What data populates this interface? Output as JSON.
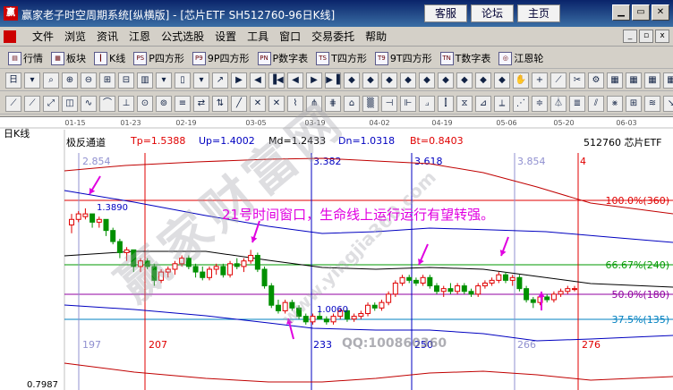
{
  "window": {
    "title": "赢家老子时空周期系统[纵横版] - [芯片ETF  SH512760-96日K线]",
    "top_links": [
      "客服",
      "论坛",
      "主页"
    ],
    "app_icon": "赢"
  },
  "menu": {
    "items": [
      "文件",
      "浏览",
      "资讯",
      "江恩",
      "公式选股",
      "设置",
      "工具",
      "窗口",
      "交易委托",
      "帮助"
    ]
  },
  "toolbar1": {
    "items": [
      {
        "icon": "market-icon",
        "glyph": "▤",
        "label": "行情"
      },
      {
        "icon": "sector-icon",
        "glyph": "▦",
        "label": "板块"
      },
      {
        "icon": "kline-icon",
        "glyph": "┃",
        "label": "K线"
      },
      {
        "icon": "ps-icon",
        "glyph": "PS",
        "label": "P四方形"
      },
      {
        "icon": "p9-icon",
        "glyph": "P9",
        "label": "9P四方形"
      },
      {
        "icon": "pn-icon",
        "glyph": "PN",
        "label": "P数字表"
      },
      {
        "icon": "ts-icon",
        "glyph": "TS",
        "label": "T四方形"
      },
      {
        "icon": "t9-icon",
        "glyph": "T9",
        "label": "9T四方形"
      },
      {
        "icon": "tn-icon",
        "glyph": "TN",
        "label": "T数字表"
      },
      {
        "icon": "gann-wheel-icon",
        "glyph": "◎",
        "label": "江恩轮"
      }
    ]
  },
  "chart_header": {
    "panel_label": "日K线",
    "indicator_name": "极反通道",
    "values": [
      {
        "label": "Tp=1.5388",
        "color": "#e00000"
      },
      {
        "label": "Up=1.4002",
        "color": "#0000c0"
      },
      {
        "label": "Md=1.2433",
        "color": "#000000"
      },
      {
        "label": "Dn=1.0318",
        "color": "#0000c0"
      },
      {
        "label": "Bt=0.8403",
        "color": "#e00000"
      }
    ],
    "symbol": "512760 芯片ETF"
  },
  "date_axis": [
    "01-15",
    "01-23",
    "02-19",
    "03-05",
    "03-19",
    "04-02",
    "04-19",
    "05-06",
    "05-20",
    "06-03"
  ],
  "cycle_labels_top": [
    "2.854",
    "3.382",
    "3.618",
    "3.854",
    "4"
  ],
  "cycle_labels_bottom": [
    "197",
    "207",
    "233",
    "250",
    "266",
    "276"
  ],
  "price_labels": [
    "1.3890",
    "1.0060",
    "0.7987"
  ],
  "fib_levels": [
    {
      "label": "100.0%(360)"
    },
    {
      "label": "66.67%(240)"
    },
    {
      "label": "50.0%(180)"
    },
    {
      "label": "37.5%(135)"
    }
  ],
  "annotation": "21号时间窗口，生命线上运行运行有望转强。",
  "watermark": {
    "main": "赢家财富网",
    "url": "www.yingjia360.com",
    "qq": "QQ:100860360"
  },
  "chart_data": {
    "type": "candlestick",
    "symbol": "512760",
    "name": "芯片ETF",
    "period": "日K线",
    "channel": {
      "Tp": 1.5388,
      "Up": 1.4002,
      "Md": 1.2433,
      "Dn": 1.0318,
      "Bt": 0.8403
    },
    "ylim": [
      0.7987,
      1.6
    ],
    "fib_levels_pct": [
      100.0,
      66.67,
      50.0,
      37.5
    ],
    "fib_levels_deg": [
      360,
      240,
      180,
      135
    ],
    "candles": [
      {
        "o": 1.36,
        "h": 1.4,
        "l": 1.33,
        "c": 1.38
      },
      {
        "o": 1.38,
        "h": 1.41,
        "l": 1.37,
        "c": 1.4
      },
      {
        "o": 1.39,
        "h": 1.42,
        "l": 1.38,
        "c": 1.4
      },
      {
        "o": 1.4,
        "h": 1.4,
        "l": 1.35,
        "c": 1.37
      },
      {
        "o": 1.37,
        "h": 1.39,
        "l": 1.35,
        "c": 1.38
      },
      {
        "o": 1.38,
        "h": 1.38,
        "l": 1.32,
        "c": 1.34
      },
      {
        "o": 1.34,
        "h": 1.35,
        "l": 1.29,
        "c": 1.3
      },
      {
        "o": 1.3,
        "h": 1.31,
        "l": 1.24,
        "c": 1.26
      },
      {
        "o": 1.26,
        "h": 1.28,
        "l": 1.23,
        "c": 1.27
      },
      {
        "o": 1.27,
        "h": 1.27,
        "l": 1.19,
        "c": 1.21
      },
      {
        "o": 1.21,
        "h": 1.24,
        "l": 1.19,
        "c": 1.23
      },
      {
        "o": 1.23,
        "h": 1.24,
        "l": 1.2,
        "c": 1.21
      },
      {
        "o": 1.21,
        "h": 1.22,
        "l": 1.14,
        "c": 1.16
      },
      {
        "o": 1.16,
        "h": 1.2,
        "l": 1.15,
        "c": 1.19
      },
      {
        "o": 1.19,
        "h": 1.21,
        "l": 1.17,
        "c": 1.2
      },
      {
        "o": 1.2,
        "h": 1.23,
        "l": 1.18,
        "c": 1.22
      },
      {
        "o": 1.22,
        "h": 1.25,
        "l": 1.21,
        "c": 1.24
      },
      {
        "o": 1.24,
        "h": 1.25,
        "l": 1.2,
        "c": 1.21
      },
      {
        "o": 1.21,
        "h": 1.22,
        "l": 1.17,
        "c": 1.19
      },
      {
        "o": 1.19,
        "h": 1.21,
        "l": 1.16,
        "c": 1.17
      },
      {
        "o": 1.17,
        "h": 1.21,
        "l": 1.16,
        "c": 1.2
      },
      {
        "o": 1.2,
        "h": 1.22,
        "l": 1.18,
        "c": 1.21
      },
      {
        "o": 1.21,
        "h": 1.22,
        "l": 1.17,
        "c": 1.18
      },
      {
        "o": 1.18,
        "h": 1.23,
        "l": 1.17,
        "c": 1.22
      },
      {
        "o": 1.22,
        "h": 1.24,
        "l": 1.2,
        "c": 1.21
      },
      {
        "o": 1.21,
        "h": 1.24,
        "l": 1.19,
        "c": 1.23
      },
      {
        "o": 1.23,
        "h": 1.27,
        "l": 1.22,
        "c": 1.25
      },
      {
        "o": 1.25,
        "h": 1.26,
        "l": 1.19,
        "c": 1.2
      },
      {
        "o": 1.2,
        "h": 1.21,
        "l": 1.13,
        "c": 1.14
      },
      {
        "o": 1.14,
        "h": 1.15,
        "l": 1.06,
        "c": 1.07
      },
      {
        "o": 1.07,
        "h": 1.09,
        "l": 1.04,
        "c": 1.05
      },
      {
        "o": 1.05,
        "h": 1.09,
        "l": 1.04,
        "c": 1.08
      },
      {
        "o": 1.08,
        "h": 1.09,
        "l": 1.05,
        "c": 1.06
      },
      {
        "o": 1.06,
        "h": 1.07,
        "l": 1.02,
        "c": 1.03
      },
      {
        "o": 1.03,
        "h": 1.04,
        "l": 1.0,
        "c": 1.01
      },
      {
        "o": 1.01,
        "h": 1.04,
        "l": 1.0,
        "c": 1.03
      },
      {
        "o": 1.03,
        "h": 1.05,
        "l": 1.02,
        "c": 1.02
      },
      {
        "o": 1.02,
        "h": 1.03,
        "l": 1.0,
        "c": 1.01
      },
      {
        "o": 1.01,
        "h": 1.04,
        "l": 1.0,
        "c": 1.03
      },
      {
        "o": 1.03,
        "h": 1.06,
        "l": 1.02,
        "c": 1.05
      },
      {
        "o": 1.05,
        "h": 1.06,
        "l": 1.01,
        "c": 1.02
      },
      {
        "o": 1.02,
        "h": 1.04,
        "l": 1.01,
        "c": 1.03
      },
      {
        "o": 1.03,
        "h": 1.05,
        "l": 1.02,
        "c": 1.04
      },
      {
        "o": 1.04,
        "h": 1.08,
        "l": 1.03,
        "c": 1.07
      },
      {
        "o": 1.07,
        "h": 1.08,
        "l": 1.05,
        "c": 1.06
      },
      {
        "o": 1.06,
        "h": 1.09,
        "l": 1.05,
        "c": 1.08
      },
      {
        "o": 1.08,
        "h": 1.12,
        "l": 1.07,
        "c": 1.11
      },
      {
        "o": 1.11,
        "h": 1.16,
        "l": 1.1,
        "c": 1.15
      },
      {
        "o": 1.15,
        "h": 1.18,
        "l": 1.14,
        "c": 1.17
      },
      {
        "o": 1.17,
        "h": 1.18,
        "l": 1.15,
        "c": 1.16
      },
      {
        "o": 1.16,
        "h": 1.17,
        "l": 1.14,
        "c": 1.15
      },
      {
        "o": 1.15,
        "h": 1.18,
        "l": 1.14,
        "c": 1.17
      },
      {
        "o": 1.17,
        "h": 1.18,
        "l": 1.13,
        "c": 1.14
      },
      {
        "o": 1.14,
        "h": 1.15,
        "l": 1.11,
        "c": 1.12
      },
      {
        "o": 1.12,
        "h": 1.14,
        "l": 1.1,
        "c": 1.13
      },
      {
        "o": 1.13,
        "h": 1.15,
        "l": 1.11,
        "c": 1.12
      },
      {
        "o": 1.12,
        "h": 1.15,
        "l": 1.11,
        "c": 1.14
      },
      {
        "o": 1.14,
        "h": 1.15,
        "l": 1.11,
        "c": 1.12
      },
      {
        "o": 1.12,
        "h": 1.13,
        "l": 1.1,
        "c": 1.11
      },
      {
        "o": 1.11,
        "h": 1.15,
        "l": 1.1,
        "c": 1.14
      },
      {
        "o": 1.14,
        "h": 1.16,
        "l": 1.13,
        "c": 1.15
      },
      {
        "o": 1.15,
        "h": 1.17,
        "l": 1.14,
        "c": 1.16
      },
      {
        "o": 1.16,
        "h": 1.19,
        "l": 1.15,
        "c": 1.18
      },
      {
        "o": 1.18,
        "h": 1.19,
        "l": 1.15,
        "c": 1.16
      },
      {
        "o": 1.16,
        "h": 1.18,
        "l": 1.14,
        "c": 1.17
      },
      {
        "o": 1.17,
        "h": 1.18,
        "l": 1.12,
        "c": 1.13
      },
      {
        "o": 1.13,
        "h": 1.14,
        "l": 1.08,
        "c": 1.09
      },
      {
        "o": 1.09,
        "h": 1.1,
        "l": 1.06,
        "c": 1.08
      },
      {
        "o": 1.08,
        "h": 1.11,
        "l": 1.07,
        "c": 1.1
      },
      {
        "o": 1.1,
        "h": 1.11,
        "l": 1.08,
        "c": 1.09
      },
      {
        "o": 1.09,
        "h": 1.12,
        "l": 1.08,
        "c": 1.11
      },
      {
        "o": 1.11,
        "h": 1.13,
        "l": 1.1,
        "c": 1.12
      },
      {
        "o": 1.12,
        "h": 1.14,
        "l": 1.11,
        "c": 1.13
      },
      {
        "o": 1.13,
        "h": 1.14,
        "l": 1.12,
        "c": 1.13
      }
    ]
  }
}
